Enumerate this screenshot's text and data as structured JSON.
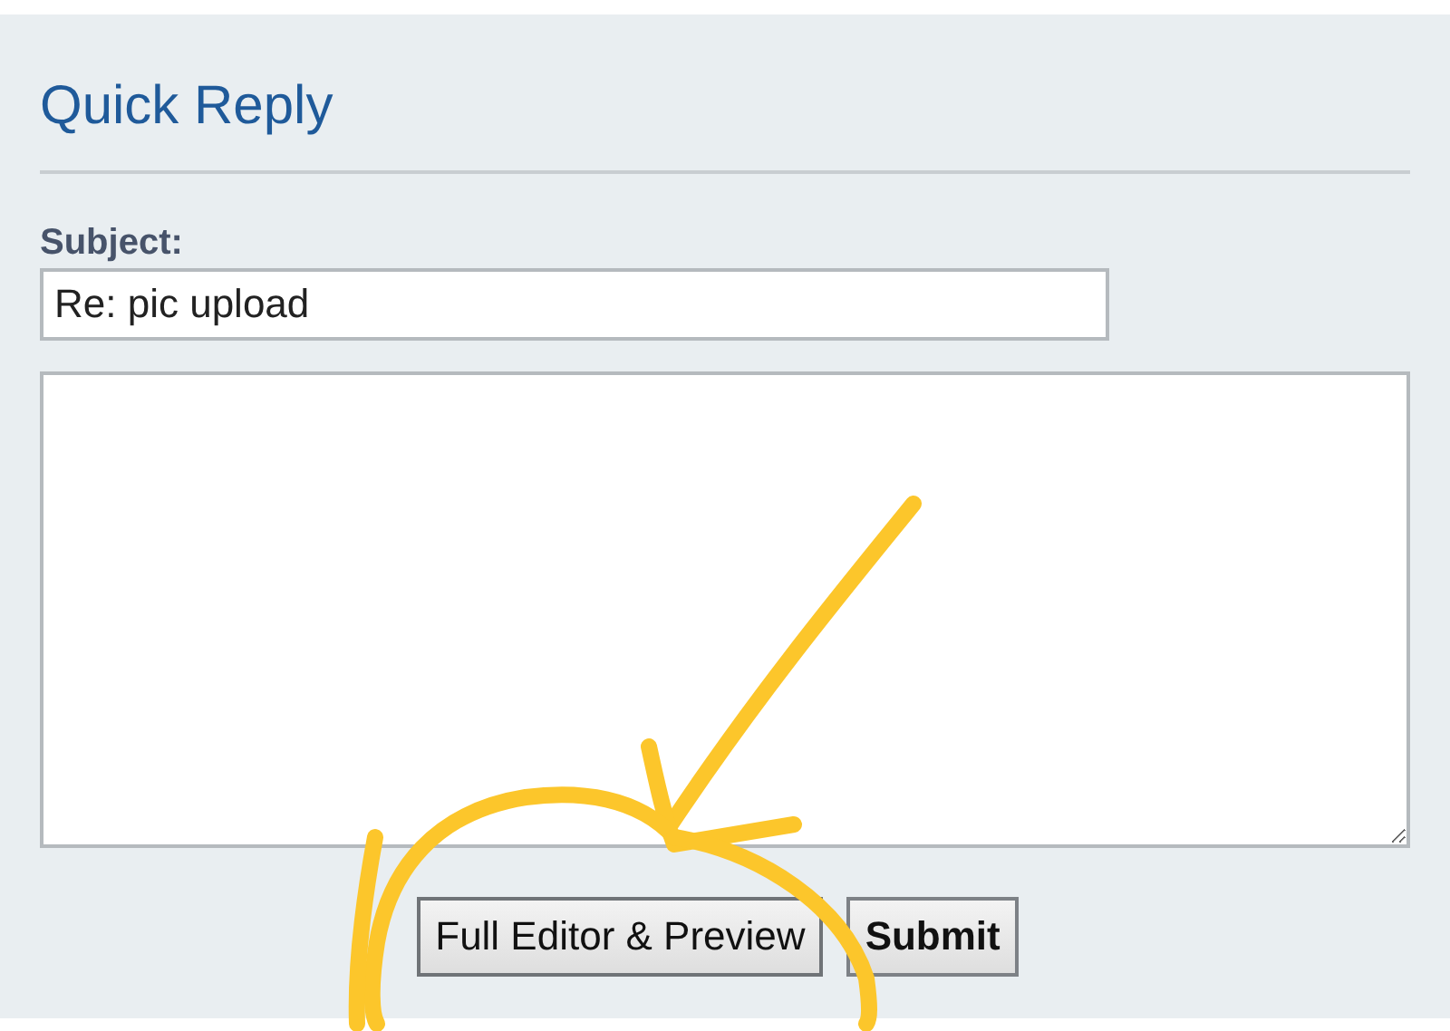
{
  "panel": {
    "title": "Quick Reply"
  },
  "subject": {
    "label": "Subject:",
    "value": "Re: pic upload"
  },
  "buttons": [
    {
      "label": "Full Editor & Preview",
      "kind": "secondary"
    },
    {
      "label": "Submit",
      "kind": "primary"
    }
  ]
}
